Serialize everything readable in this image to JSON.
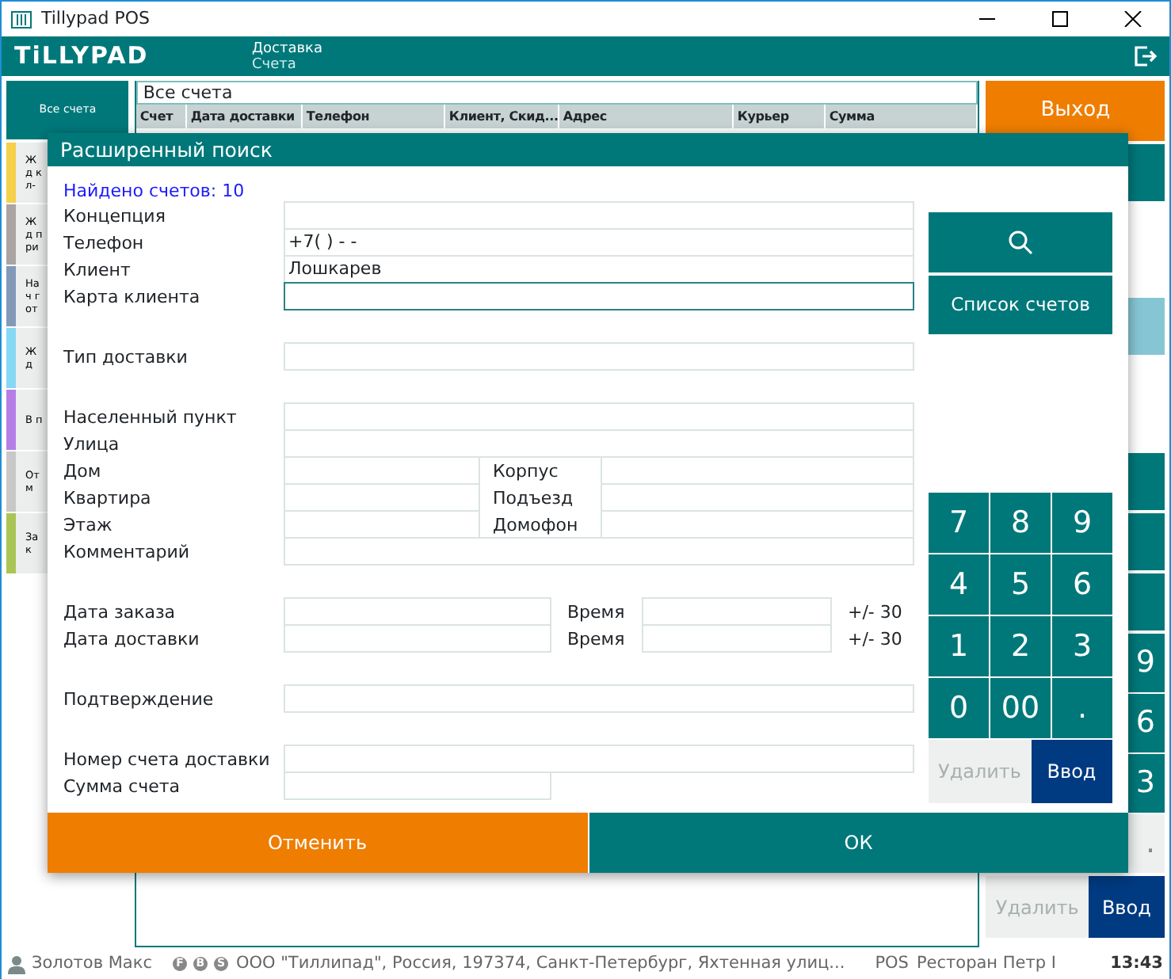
{
  "window": {
    "title": "Tillypad POS"
  },
  "header": {
    "logo": "TiLLYPAD",
    "section": "Доставка",
    "subsection": "Счета"
  },
  "sidebar": {
    "all_button": "Все счета",
    "items": [
      {
        "label": "Жд кл-",
        "color": "#f5d04a"
      },
      {
        "label": "Жд при",
        "color": "#aaa4a2"
      },
      {
        "label": "Нач гот",
        "color": "#8399b8"
      },
      {
        "label": "Жд",
        "color": "#86d8f4"
      },
      {
        "label": "В п",
        "color": "#b57ee6"
      },
      {
        "label": "Отм",
        "color": "#c8c8c8"
      },
      {
        "label": "Зак",
        "color": "#a9c655"
      }
    ]
  },
  "list": {
    "filter": "Все счета",
    "columns": [
      "Счет",
      "Дата доставки",
      "Телефон",
      "Клиент, Скид...",
      "Адрес",
      "Курьер",
      "Сумма"
    ]
  },
  "right_panel": {
    "exit": "Выход",
    "keys": [
      "9",
      "6",
      "3",
      "."
    ],
    "delete": "Удалить",
    "enter": "Ввод"
  },
  "dialog": {
    "title": "Расширенный поиск",
    "found": "Найдено счетов: 10",
    "groups": [
      [
        {
          "kind": "text",
          "label": "Концепция",
          "focused": false
        },
        {
          "kind": "text",
          "label": "Телефон",
          "value": "+7(  )  -  -",
          "focused": false
        },
        {
          "kind": "text",
          "label": "Клиент",
          "value": "Лошкарев",
          "focused": false
        },
        {
          "kind": "text",
          "label": "Карта клиента",
          "focused": true
        }
      ],
      [
        {
          "kind": "text",
          "label": "Тип доставки",
          "focused": false
        }
      ],
      [
        {
          "kind": "text",
          "label": "Населенный пункт",
          "focused": false
        },
        {
          "kind": "text",
          "label": "Улица",
          "focused": false
        },
        {
          "kind": "pair",
          "label": "Дом",
          "label_2": "Корпус",
          "focused": false
        },
        {
          "kind": "pair",
          "label": "Квартира",
          "label_2": "Подъезд",
          "focused": false
        },
        {
          "kind": "pair",
          "label": "Этаж",
          "label_2": "Домофон",
          "focused": false
        },
        {
          "kind": "text",
          "label": "Комментарий",
          "focused": false
        }
      ],
      [
        {
          "kind": "datetime",
          "label": "Дата заказа",
          "time_label": "Время",
          "tolerance": "+/- 30",
          "focused": false
        },
        {
          "kind": "datetime",
          "label": "Дата доставки",
          "time_label": "Время",
          "tolerance": "+/- 30",
          "focused": false
        }
      ],
      [
        {
          "kind": "text",
          "label": "Подтверждение",
          "focused": false
        }
      ],
      [
        {
          "kind": "text",
          "label": "Номер счета доставки",
          "focused": false
        },
        {
          "kind": "short",
          "label": "Сумма счета",
          "focused": false
        }
      ]
    ],
    "list_button": "Список счетов",
    "keys": [
      "7",
      "8",
      "9",
      "4",
      "5",
      "6",
      "1",
      "2",
      "3",
      "0",
      "00",
      "."
    ],
    "delete": {
      "label": "Удалить",
      "disabled": true
    },
    "enter": "Ввод",
    "cancel": "Отменить",
    "ok": "ОК"
  },
  "status_bar": {
    "user": "Золотов Макс",
    "badges": [
      "F",
      "B",
      "S"
    ],
    "company": "ООО \"Тиллипад\", Россия, 197374, Санкт-Петербург, Яхтенная улиц...",
    "terminal": "POS",
    "restaurant": "Ресторан Петр I",
    "time": "13:43"
  }
}
